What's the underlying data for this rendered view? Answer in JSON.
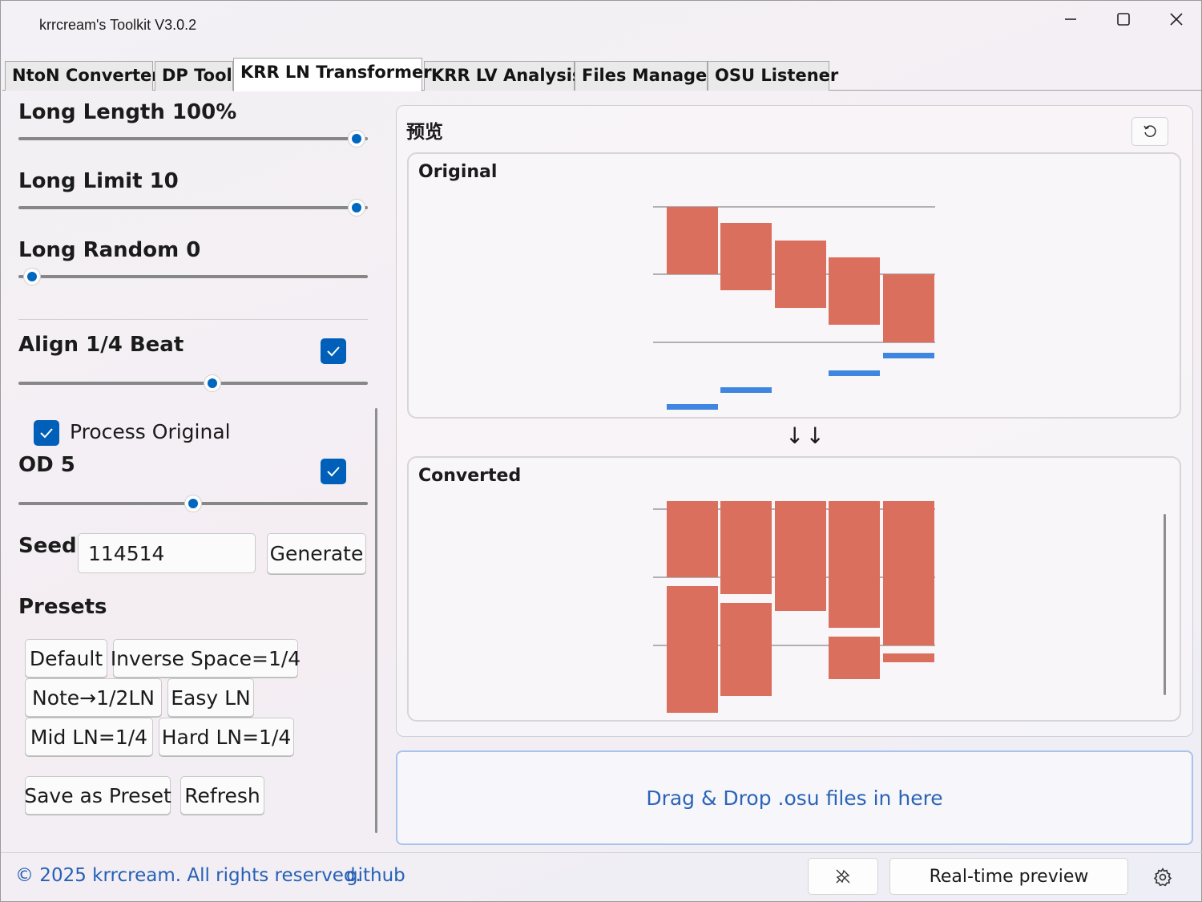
{
  "window": {
    "title": "krrcream's Toolkit V3.0.2"
  },
  "tabs": [
    {
      "label": "NtoN Converter",
      "active": false
    },
    {
      "label": "DP Tool",
      "active": false
    },
    {
      "label": "KRR LN Transformer",
      "active": true
    },
    {
      "label": "KRR LV Analysis",
      "active": false
    },
    {
      "label": "Files Manager",
      "active": false
    },
    {
      "label": "OSU Listener",
      "active": false
    }
  ],
  "settings": {
    "long_length": {
      "label": "Long Length 100%",
      "value_fraction": 1.0
    },
    "long_limit": {
      "label": "Long Limit 10",
      "value_fraction": 1.0
    },
    "long_random": {
      "label": "Long Random 0",
      "value_fraction": 0.0
    },
    "align": {
      "label": "Align 1/4 Beat",
      "checked": true,
      "value_fraction": 0.56
    },
    "process_original": {
      "label": "Process Original",
      "checked": true
    },
    "od": {
      "label": "OD 5",
      "checked": true,
      "value_fraction": 0.5
    },
    "seed": {
      "label": "Seed",
      "value": "114514",
      "generate_label": "Generate"
    }
  },
  "presets": {
    "title": "Presets",
    "items": [
      "Default",
      "Inverse Space=1/4",
      "Note→1/2LN",
      "Easy LN",
      "Mid LN=1/4",
      "Hard LN=1/4"
    ],
    "save_label": "Save as Preset",
    "refresh_label": "Refresh"
  },
  "preview": {
    "title": "预览",
    "original_title": "Original",
    "converted_title": "Converted",
    "arrows": "↓↓",
    "note_color": "#d96f5c",
    "short_note_color": "#3f86e0"
  },
  "drop_zone": {
    "text": "Drag & Drop .osu files in here"
  },
  "footer": {
    "copyright": "© 2025 krrcream. All rights reserved.",
    "github": "github",
    "realtime_label": "Real-time preview",
    "link_color": "#2660b5"
  }
}
